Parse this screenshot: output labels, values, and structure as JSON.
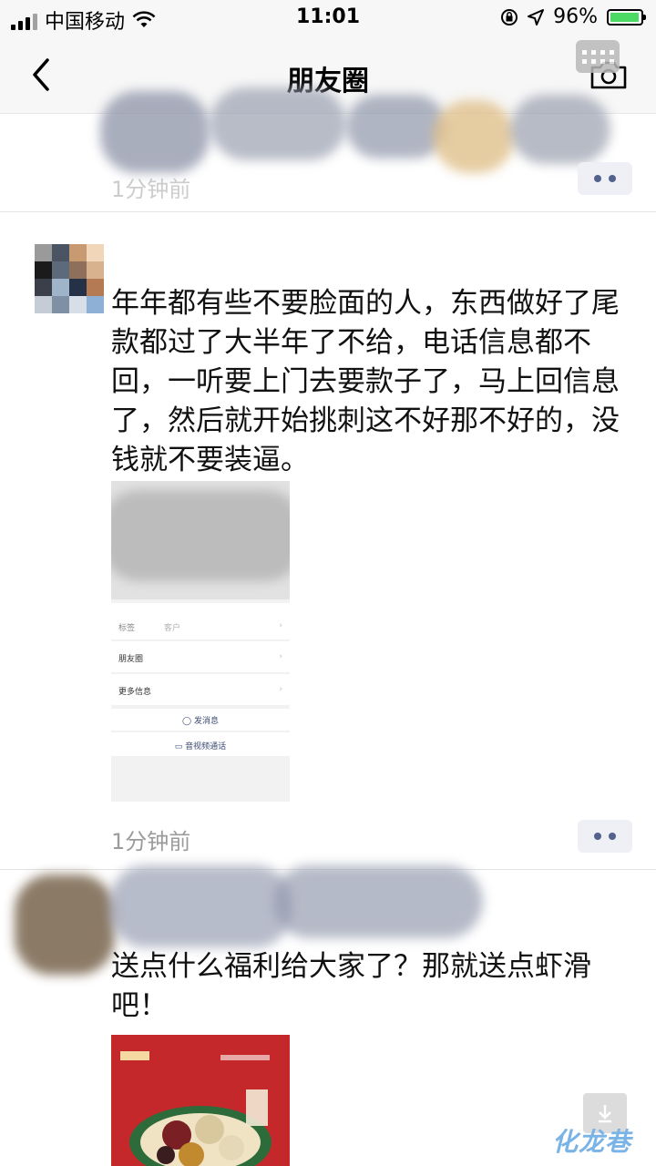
{
  "status_bar": {
    "carrier": "中国移动",
    "time": "11:01",
    "battery": "96%"
  },
  "nav": {
    "title": "朋友圈"
  },
  "top_post": {
    "time": "1分钟前"
  },
  "post": {
    "text": "年年都有些不要脸面的人，东西做好了尾款都过了大半年了不给，电话信息都不回，一听要上门去要款子了，马上回信息了，然后就开始挑刺这不好那不好的，没钱就不要装逼。",
    "time": "1分钟前",
    "screenshot": {
      "row1_label": "标签",
      "row1_value": "客户",
      "row2_label": "朋友圈",
      "row3_label": "更多信息",
      "send_message": "发消息",
      "video_call": "音视频通话"
    }
  },
  "post2": {
    "text": "送点什么福利给大家了？那就送点虾滑吧！"
  },
  "watermark": "化龙巷",
  "colors": {
    "bar_bg": "#f7f7f7",
    "link_blue": "#52628c",
    "battery_green": "#4cd964",
    "ad_red": "#c5282a"
  },
  "icons": [
    "back-icon",
    "camera-icon",
    "grid-icon",
    "wifi-icon",
    "location-icon",
    "lock-rotation-icon",
    "more-icon",
    "download-icon"
  ]
}
